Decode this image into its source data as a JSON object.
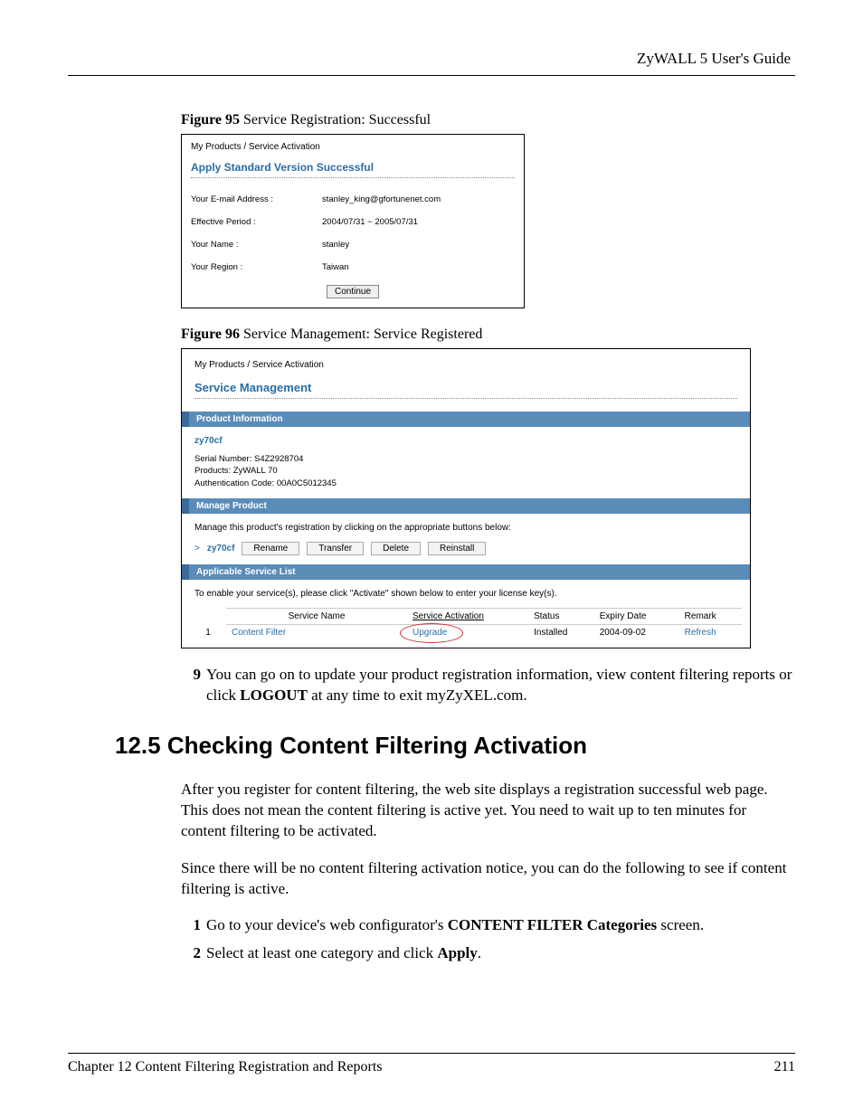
{
  "header": {
    "guide": "ZyWALL 5 User's Guide"
  },
  "fig95": {
    "caption_bold": "Figure 95",
    "caption_rest": "   Service Registration: Successful",
    "breadcrumb": "My Products / Service Activation",
    "title": "Apply Standard Version Successful",
    "rows": {
      "email_label": "Your E-mail Address :",
      "email_value": "stanley_king@gfortunenet.com",
      "period_label": "Effective Period :",
      "period_value": "2004/07/31 ~ 2005/07/31",
      "name_label": "Your Name :",
      "name_value": "stanley",
      "region_label": "Your Region :",
      "region_value": "Taiwan"
    },
    "continue": "Continue"
  },
  "fig96": {
    "caption_bold": "Figure 96",
    "caption_rest": "   Service Management: Service Registered",
    "breadcrumb": "My Products / Service Activation",
    "title": "Service Management",
    "sec1_title": "Product Information",
    "product_name": "zy70cf",
    "serial": "Serial Number: S4Z2928704",
    "products": "Products: ZyWALL 70",
    "auth": "Authentication Code: 00A0C5012345",
    "sec2_title": "Manage Product",
    "manage_intro": "Manage this product's registration by clicking on the appropriate buttons below:",
    "arrow": ">",
    "pname": "zy70cf",
    "btn_rename": "Rename",
    "btn_transfer": "Transfer",
    "btn_delete": "Delete",
    "btn_reinstall": "Reinstall",
    "sec3_title": "Applicable Service List",
    "svc_intro": "To enable your service(s), please click \"Activate\" shown below to enter your license key(s).",
    "th_service": "Service Name",
    "th_activation": "Service Activation",
    "th_status": "Status",
    "th_expiry": "Expiry Date",
    "th_remark": "Remark",
    "row1_num": "1",
    "row1_name": "Content Filter",
    "row1_activation": "Upgrade",
    "row1_status": "Installed",
    "row1_expiry": "2004-09-02",
    "row1_remark": "Refresh"
  },
  "step9": {
    "num": "9",
    "text_before": "You can go on to update your product registration information, view content filtering reports or click ",
    "logout": "LOGOUT",
    "text_after": " at any time to exit myZyXEL.com."
  },
  "section": {
    "heading": "12.5  Checking Content Filtering Activation",
    "p1": "After you register for content filtering, the web site displays a registration successful web page. This does not mean the content filtering is active yet. You need to wait up to ten minutes for content filtering to be activated.",
    "p2": "Since there will be no content filtering activation notice, you can do the following to see if content filtering is active.",
    "s1num": "1",
    "s1_before": "Go to your device's web configurator's ",
    "s1_bold": "CONTENT FILTER Categories",
    "s1_after": " screen.",
    "s2num": "2",
    "s2_before": "Select at least one category and click ",
    "s2_bold": "Apply",
    "s2_after": "."
  },
  "footer": {
    "chapter": "Chapter 12 Content Filtering Registration and Reports",
    "page": "211"
  }
}
